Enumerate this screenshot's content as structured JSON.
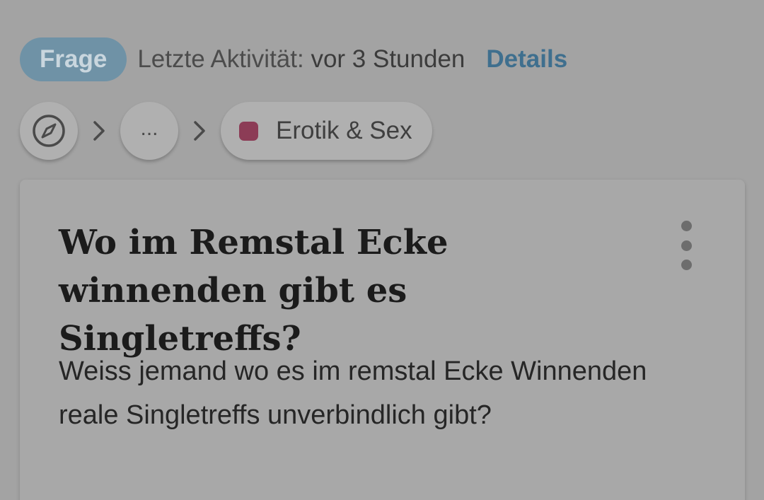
{
  "meta": {
    "badge": "Frage",
    "activity_label": "Letzte Aktivität:",
    "activity_value": "vor 3 Stunden",
    "details_link": "Details"
  },
  "breadcrumb": {
    "ellipsis": "...",
    "topic_label": "Erotik & Sex",
    "topic_color": "#8c3c56"
  },
  "question": {
    "title": "Wo im Remstal Ecke winnenden gibt es Singletreffs?",
    "body": "Weiss jemand wo es im remstal Ecke Winnenden reale Singletreffs unverbindlich gibt?"
  },
  "icons": {
    "home": "compass-icon",
    "separator": "chevron-right-icon",
    "menu": "more-vertical-icon"
  }
}
